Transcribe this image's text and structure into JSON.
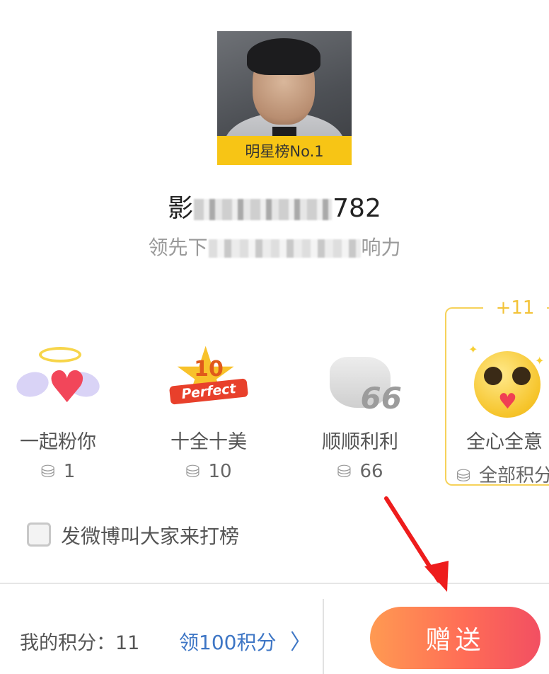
{
  "star": {
    "rank_badge": "明星榜No.1",
    "name_prefix": "影",
    "name_suffix": "782",
    "subtitle_prefix": "领先下",
    "subtitle_suffix": "响力"
  },
  "gifts": [
    {
      "label": "一起粉你",
      "cost": "1",
      "icon": "winged-heart-icon"
    },
    {
      "label": "十全十美",
      "cost": "10",
      "icon": "perfect-10-star-icon",
      "icon_text": "10",
      "icon_sub": "Perfect"
    },
    {
      "label": "顺顺利利",
      "cost": "66",
      "icon": "hand-66-icon",
      "icon_text": "66"
    },
    {
      "label": "全心全意",
      "cost": "全部积分",
      "icon": "heart-eyes-emoji-icon",
      "bonus": "+11",
      "selected": true
    }
  ],
  "share": {
    "label": "发微博叫大家来打榜",
    "checked": false
  },
  "footer": {
    "my_points": "我的积分：11",
    "earn_link": "领100积分",
    "send_button": "赠送"
  },
  "colors": {
    "badge": "#f7c515",
    "accent": "#f6d25a",
    "link": "#3e76c5",
    "button_start": "#ff9a52",
    "button_end": "#f24f62"
  }
}
